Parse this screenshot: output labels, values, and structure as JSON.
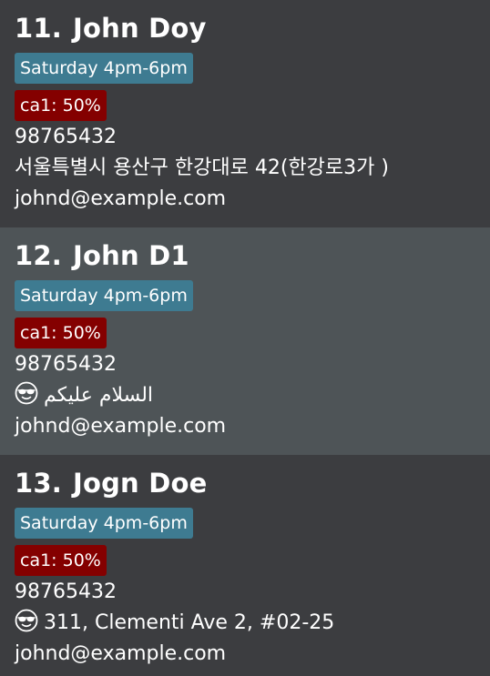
{
  "persons": [
    {
      "index": "11.",
      "name": "John Doy",
      "session": "Saturday 4pm-6pm",
      "grade": "ca1: 50%",
      "phone": "98765432",
      "address": "서울특별시 용산구 한강대로 42(한강로3가 )",
      "address_icon": "",
      "email": "johnd@example.com"
    },
    {
      "index": "12.",
      "name": "John D1",
      "session": "Saturday 4pm-6pm",
      "grade": "ca1: 50%",
      "phone": "98765432",
      "address": "السلام عليكم",
      "address_icon": "sunglasses-emoji-icon",
      "email": "johnd@example.com"
    },
    {
      "index": "13.",
      "name": "Jogn Doe",
      "session": "Saturday 4pm-6pm",
      "grade": "ca1: 50%",
      "phone": "98765432",
      "address": "311, Clementi Ave 2, #02-25",
      "address_icon": "sunglasses-emoji-icon",
      "email": "johnd@example.com"
    }
  ],
  "colors": {
    "card_dark": "#3c3d40",
    "card_light": "#4e5457",
    "session_tag": "#3e7b91",
    "grade_tag": "#840000",
    "text": "#ffffff"
  }
}
